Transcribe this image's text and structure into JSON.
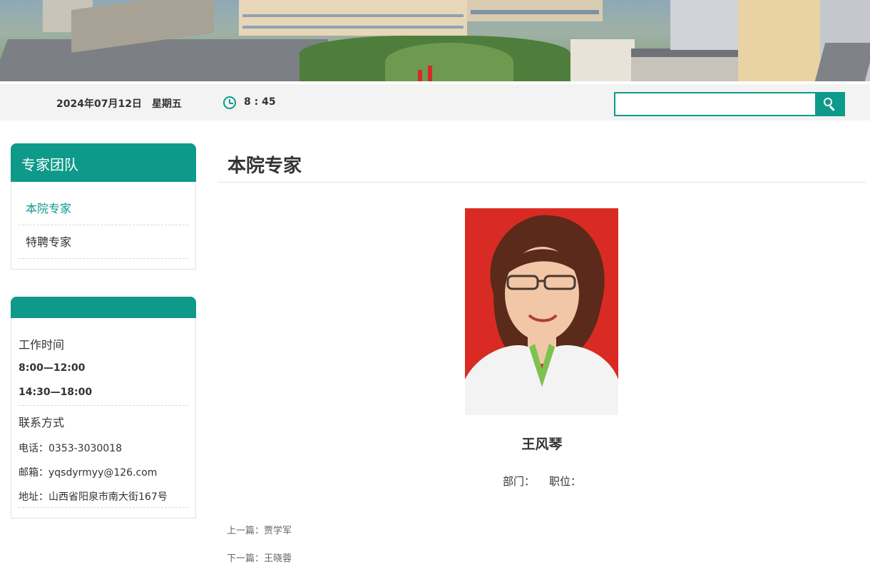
{
  "header": {
    "date": "2024年07月12日",
    "weekday": "星期五",
    "time": "8 : 45",
    "search_placeholder": ""
  },
  "sidebar": {
    "team_title": "专家团队",
    "nav_items": [
      {
        "label": "本院专家",
        "active": true
      },
      {
        "label": "特聘专家",
        "active": false
      }
    ],
    "contact": {
      "work_hours_label": "工作时间",
      "hours_morning": "8:00—12:00",
      "hours_afternoon": "14:30—18:00",
      "contact_label": "联系方式",
      "phone": "电话：0353-3030018",
      "email": "邮箱：yqsdyrmyy@126.com",
      "address": "地址：山西省阳泉市南大街167号"
    }
  },
  "main": {
    "page_title": "本院专家",
    "doctor_name": "王风琴",
    "department_label": "部门：",
    "position_label": "职位：",
    "prev_link": "上一篇：贾学军",
    "next_link": "下一篇：王晓蓉"
  },
  "colors": {
    "accent": "#0e9a8a",
    "portrait_bg": "#d92b24"
  }
}
